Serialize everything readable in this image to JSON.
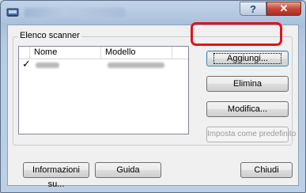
{
  "window": {
    "title": "",
    "help_glyph": "?",
    "close_glyph": "✕"
  },
  "scanner_group": {
    "label": "Elenco scanner",
    "columns": [
      "Nome",
      "Modello"
    ],
    "rows": [
      {
        "checked": true,
        "check_glyph": "✓"
      }
    ]
  },
  "side_buttons": {
    "add": "Aggiungi...",
    "delete": "Elimina",
    "modify": "Modifica...",
    "set_default": "Imposta come predefinito"
  },
  "bottom_buttons": {
    "info": "Informazioni su...",
    "guide": "Guida",
    "close": "Chiudi"
  },
  "colors": {
    "highlight": "#e1141b",
    "close_button": "#c4473a"
  }
}
